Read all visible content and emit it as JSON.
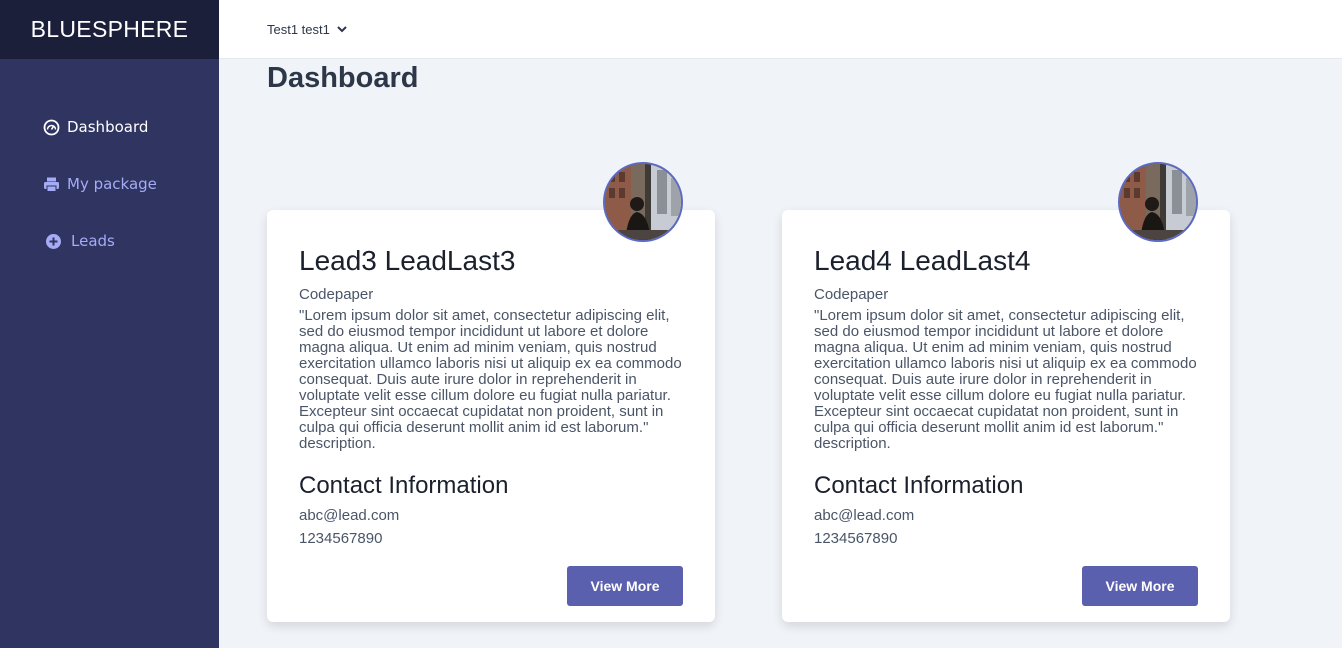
{
  "brand": "BLUESPHERE",
  "sidebar": {
    "items": [
      {
        "label": "Dashboard",
        "icon": "dashboard-gauge-icon",
        "active": true
      },
      {
        "label": "My package",
        "icon": "printer-icon",
        "active": false
      },
      {
        "label": "Leads",
        "icon": "plus-circle-icon",
        "active": false
      }
    ]
  },
  "header": {
    "user": "Test1 test1",
    "icon": "chevron-down-icon"
  },
  "page": {
    "title": "Dashboard"
  },
  "leads": [
    {
      "name": "Lead3 LeadLast3",
      "company": "Codepaper",
      "description": "\"Lorem ipsum dolor sit amet, consectetur adipiscing elit, sed do eiusmod tempor incididunt ut labore et dolore magna aliqua. Ut enim ad minim veniam, quis nostrud exercitation ullamco laboris nisi ut aliquip ex ea commodo consequat. Duis aute irure dolor in reprehenderit in voluptate velit esse cillum dolore eu fugiat nulla pariatur. Excepteur sint occaecat cupidatat non proident, sunt in culpa qui officia deserunt mollit anim id est laborum.\" description.",
      "contact_title": "Contact Information",
      "email": "abc@lead.com",
      "phone": "1234567890",
      "button": "View More"
    },
    {
      "name": "Lead4 LeadLast4",
      "company": "Codepaper",
      "description": "\"Lorem ipsum dolor sit amet, consectetur adipiscing elit, sed do eiusmod tempor incididunt ut labore et dolore magna aliqua. Ut enim ad minim veniam, quis nostrud exercitation ullamco laboris nisi ut aliquip ex ea commodo consequat. Duis aute irure dolor in reprehenderit in voluptate velit esse cillum dolore eu fugiat nulla pariatur. Excepteur sint occaecat cupidatat non proident, sunt in culpa qui officia deserunt mollit anim id est laborum.\" description.",
      "contact_title": "Contact Information",
      "email": "abc@lead.com",
      "phone": "1234567890",
      "button": "View More"
    }
  ],
  "colors": {
    "sidebar": "#2f3460",
    "brand_bg": "#1b1f3a",
    "nav_inactive": "#a5abf5",
    "button": "#5a5fae",
    "background": "#f0f3f8"
  }
}
